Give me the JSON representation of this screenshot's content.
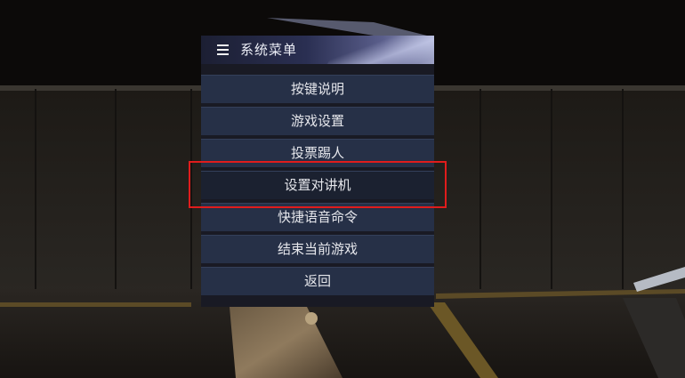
{
  "menu": {
    "title": "系统菜单",
    "icon": "hamburger-icon",
    "items": [
      {
        "label": "按键说明"
      },
      {
        "label": "游戏设置"
      },
      {
        "label": "投票踢人"
      },
      {
        "label": "设置对讲机"
      },
      {
        "label": "快捷语音命令"
      },
      {
        "label": "结束当前游戏"
      },
      {
        "label": "返回"
      }
    ]
  },
  "annotation": {
    "highlighted_item": "设置对讲机",
    "color": "#e01c1c"
  },
  "colors": {
    "panel": "#191a24",
    "item": "#263047",
    "text": "#e6e7ec"
  }
}
